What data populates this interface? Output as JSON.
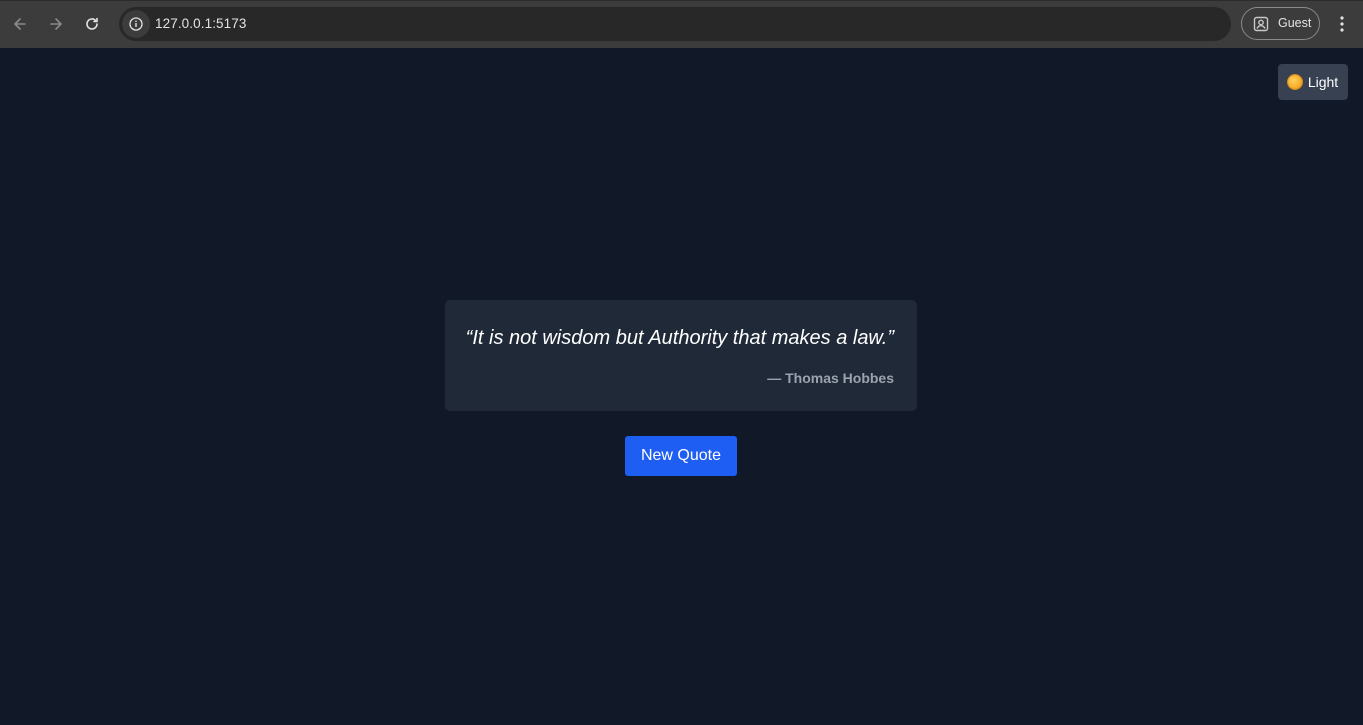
{
  "browser": {
    "url": "127.0.0.1:5173",
    "profile_label": "Guest",
    "icons": {
      "back": "arrow-left-icon",
      "forward": "arrow-right-icon",
      "reload": "reload-icon",
      "site_info": "info-icon",
      "profile": "profile-icon",
      "menu": "kebab-menu-icon"
    }
  },
  "page": {
    "theme_toggle": {
      "icon": "sun-icon",
      "label": "Light"
    },
    "quote": {
      "text": "“It is not wisdom but Authority that makes a law.”",
      "author": "— Thomas Hobbes"
    },
    "new_quote_button": "New Quote"
  },
  "colors": {
    "background": "#111827",
    "card": "#1f2937",
    "toggle": "#374151",
    "button": "#1e5ef2",
    "author_text": "#9ca3af"
  }
}
